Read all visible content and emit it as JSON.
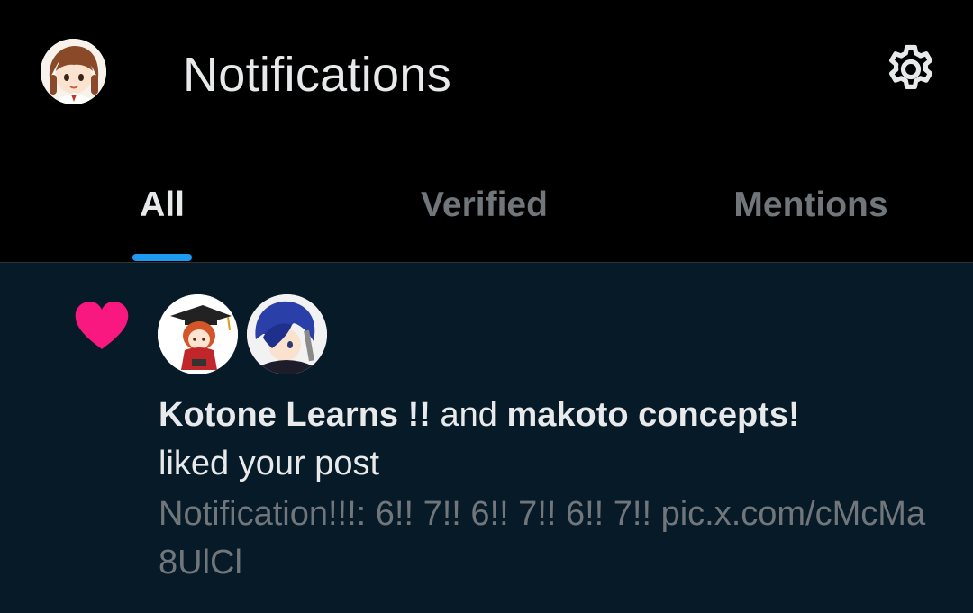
{
  "header": {
    "title": "Notifications",
    "avatar_icon": "profile-avatar",
    "settings_icon": "gear-icon"
  },
  "tabs": [
    {
      "label": "All",
      "active": true
    },
    {
      "label": "Verified",
      "active": false
    },
    {
      "label": "Mentions",
      "active": false
    }
  ],
  "notification": {
    "type_icon": "heart-icon",
    "icon_color": "#f91880",
    "user1": "Kotone Learns !!",
    "connector": "and",
    "user2": "makoto concepts!",
    "action": "liked your post",
    "post_text": "Notification!!!: 6!! 7!! 6!! 7!! 6!! 7!! pic.x.com/cMcMa8UlCl"
  },
  "colors": {
    "background": "#000000",
    "notification_bg": "#061a28",
    "accent": "#1d9bf0",
    "muted_text": "#71767b",
    "primary_text": "#e7e9ea"
  }
}
